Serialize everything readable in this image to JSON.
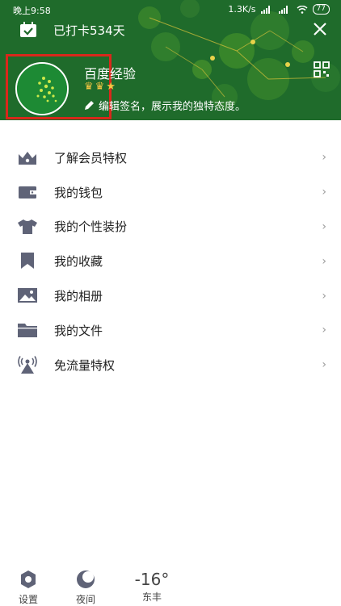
{
  "status_bar": {
    "time": "晚上9:58",
    "network_speed": "1.3K/s",
    "battery": "77"
  },
  "header": {
    "checkin_text": "已打卡534天"
  },
  "profile": {
    "username": "百度经验",
    "signature": "编辑签名，展示我的独特态度。"
  },
  "menu": {
    "items": [
      {
        "label": "了解会员特权",
        "icon": "crown-icon"
      },
      {
        "label": "我的钱包",
        "icon": "wallet-icon"
      },
      {
        "label": "我的个性装扮",
        "icon": "shirt-icon"
      },
      {
        "label": "我的收藏",
        "icon": "bookmark-icon"
      },
      {
        "label": "我的相册",
        "icon": "image-icon"
      },
      {
        "label": "我的文件",
        "icon": "folder-icon"
      },
      {
        "label": "免流量特权",
        "icon": "signal-tower-icon"
      }
    ],
    "chevron": "›"
  },
  "bottom_bar": {
    "settings_label": "设置",
    "night_label": "夜间",
    "temperature": "-16°",
    "city": "东丰"
  },
  "colors": {
    "header_bg": "#1f6b2b",
    "highlight": "#d9281b",
    "icon_gray": "#5f6377"
  }
}
